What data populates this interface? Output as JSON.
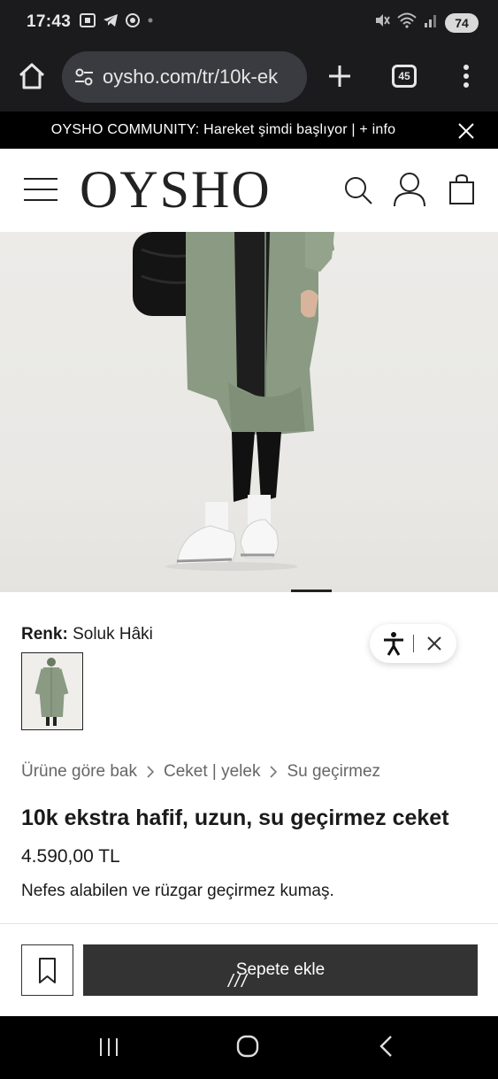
{
  "status_bar": {
    "time": "17:43",
    "battery": "74"
  },
  "browser": {
    "url": "oysho.com/tr/10k-ek",
    "tab_count": "45"
  },
  "announcement": {
    "text": "OYSHO COMMUNITY: Hareket şimdi başlıyor | + info"
  },
  "header": {
    "logo": "OYSHO"
  },
  "product": {
    "color_label": "Renk:",
    "color_value": "Soluk Hâki",
    "breadcrumb": [
      "Ürüne göre bak",
      "Ceket | yelek",
      "Su geçirmez"
    ],
    "title": "10k ekstra hafif, uzun, su geçirmez ceket",
    "price": "4.590,00 TL",
    "description": "Nefes alabilen ve rüzgar geçirmez kumaş."
  },
  "actions": {
    "add_to_cart": "Sepete ekle",
    "loader": "///"
  }
}
